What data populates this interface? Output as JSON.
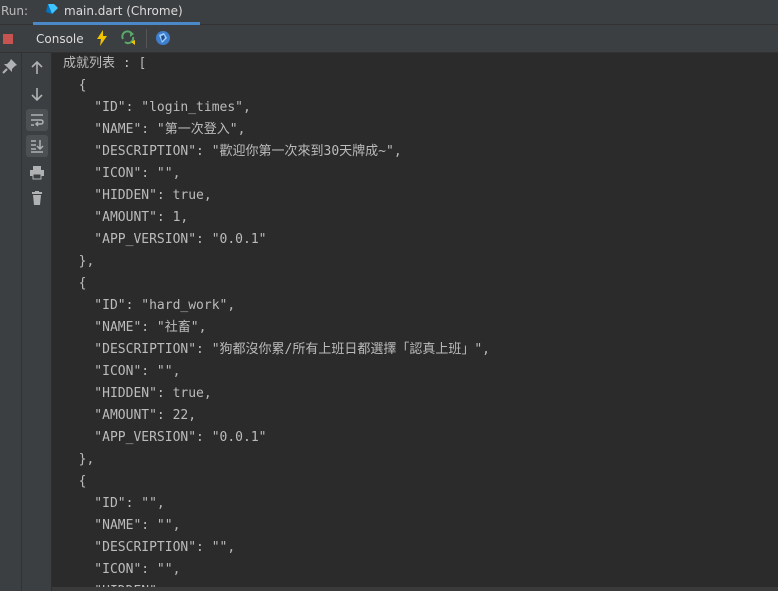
{
  "titlebar": {
    "run_label": "Run:",
    "tab_label": "main.dart (Chrome)"
  },
  "toolbar": {
    "console_tab": "Console"
  },
  "icons": {
    "stop": "stop-icon",
    "pin": "pin-icon",
    "hot_reload": "lightning-icon",
    "hot_restart": "restart-icon",
    "devtools": "dart-devtools-icon",
    "scroll_up": "arrow-up-icon",
    "scroll_down": "arrow-down-icon",
    "soft_wrap": "soft-wrap-icon",
    "scroll_to_end": "scroll-to-end-icon",
    "print": "print-icon",
    "clear": "trash-icon"
  },
  "colors": {
    "accent": "#4a88c7",
    "stop": "#c75450",
    "hot_reload": "#f0c400",
    "hot_restart": "#59a869"
  },
  "console": {
    "lines": [
      "成就列表 : [",
      "  {",
      "    \"ID\": \"login_times\",",
      "    \"NAME\": \"第一次登入\",",
      "    \"DESCRIPTION\": \"歡迎你第一次來到30天牌成~\",",
      "    \"ICON\": \"\",",
      "    \"HIDDEN\": true,",
      "    \"AMOUNT\": 1,",
      "    \"APP_VERSION\": \"0.0.1\"",
      "  },",
      "  {",
      "    \"ID\": \"hard_work\",",
      "    \"NAME\": \"社畜\",",
      "    \"DESCRIPTION\": \"狗都沒你累/所有上班日都選擇「認真上班」\",",
      "    \"ICON\": \"\",",
      "    \"HIDDEN\": true,",
      "    \"AMOUNT\": 22,",
      "    \"APP_VERSION\": \"0.0.1\"",
      "  },",
      "  {",
      "    \"ID\": \"\",",
      "    \"NAME\": \"\",",
      "    \"DESCRIPTION\": \"\",",
      "    \"ICON\": \"\",",
      "    \"HIDDEN\": ,"
    ]
  }
}
